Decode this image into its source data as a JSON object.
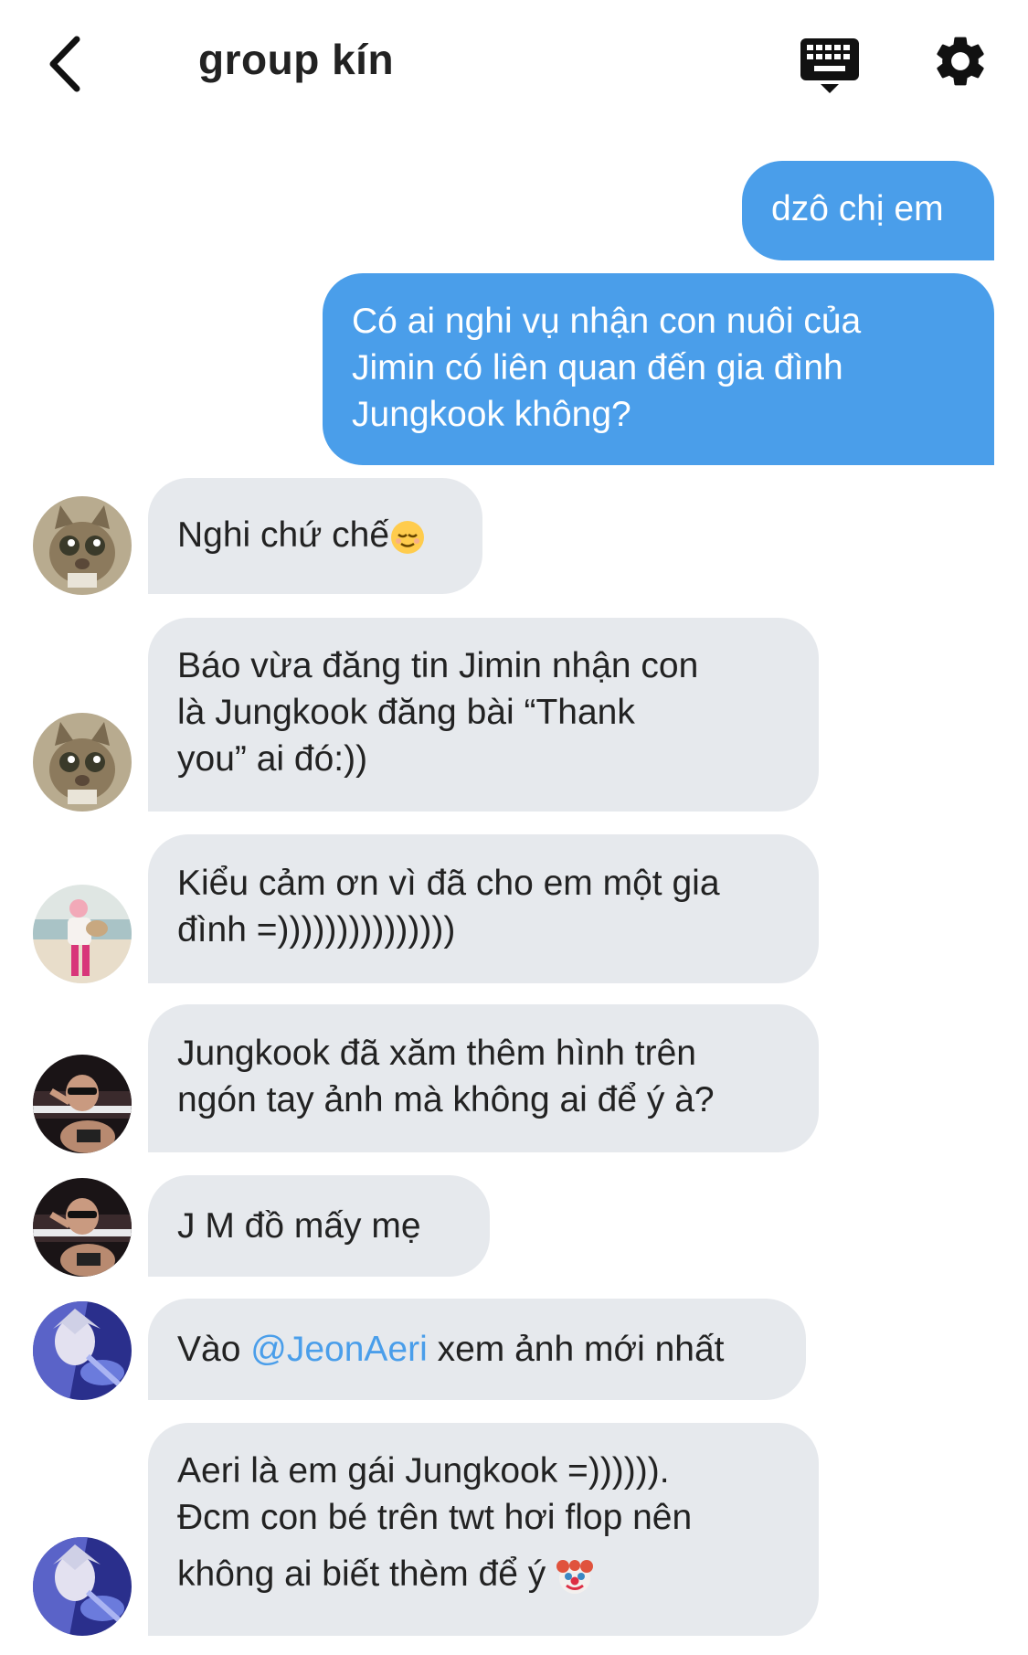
{
  "header": {
    "title": "group kín",
    "back_icon": "chevron-left-icon",
    "keyboard_icon": "keyboard-icon",
    "settings_icon": "gear-icon"
  },
  "colors": {
    "outgoing_bubble": "#4a9eea",
    "incoming_bubble": "#e6e9ed",
    "mention": "#4a9eea"
  },
  "messages": [
    {
      "direction": "outgoing",
      "text": "dzô chị em"
    },
    {
      "direction": "outgoing",
      "lines": [
        "Có ai nghi vụ nhận con nuôi của",
        "Jimin có liên quan đến gia đình",
        "Jungkook không?"
      ]
    },
    {
      "direction": "incoming",
      "avatar": "cat-avatar",
      "text": "Nghi chứ chế",
      "emoji": "relieved-face-emoji"
    },
    {
      "direction": "incoming",
      "avatar": "cat-avatar",
      "lines": [
        "Báo vừa đăng tin Jimin nhận con",
        "là Jungkook đăng bài “Thank",
        "you” ai đó:))"
      ]
    },
    {
      "direction": "incoming",
      "avatar": "person-beach-avatar",
      "lines": [
        "Kiểu cảm ơn vì đã cho em một gia",
        "đình =)))))))))))))))"
      ]
    },
    {
      "direction": "incoming",
      "avatar": "sunglasses-pool-avatar",
      "lines": [
        "Jungkook đã xăm thêm hình trên",
        "ngón tay ảnh mà không ai để ý à?"
      ]
    },
    {
      "direction": "incoming",
      "avatar": "sunglasses-pool-avatar",
      "text": "J M đồ mấy mẹ"
    },
    {
      "direction": "incoming",
      "avatar": "anime-blue-avatar",
      "prefix": "Vào ",
      "mention": "@JeonAeri",
      "suffix": " xem ảnh mới nhất"
    },
    {
      "direction": "incoming",
      "avatar": "anime-blue-avatar",
      "lines": [
        "Aeri là em gái Jungkook =)))))).",
        "Đcm con bé trên twt hơi flop nên",
        "không ai biết thèm để ý"
      ],
      "emoji": "clown-face-emoji"
    }
  ]
}
